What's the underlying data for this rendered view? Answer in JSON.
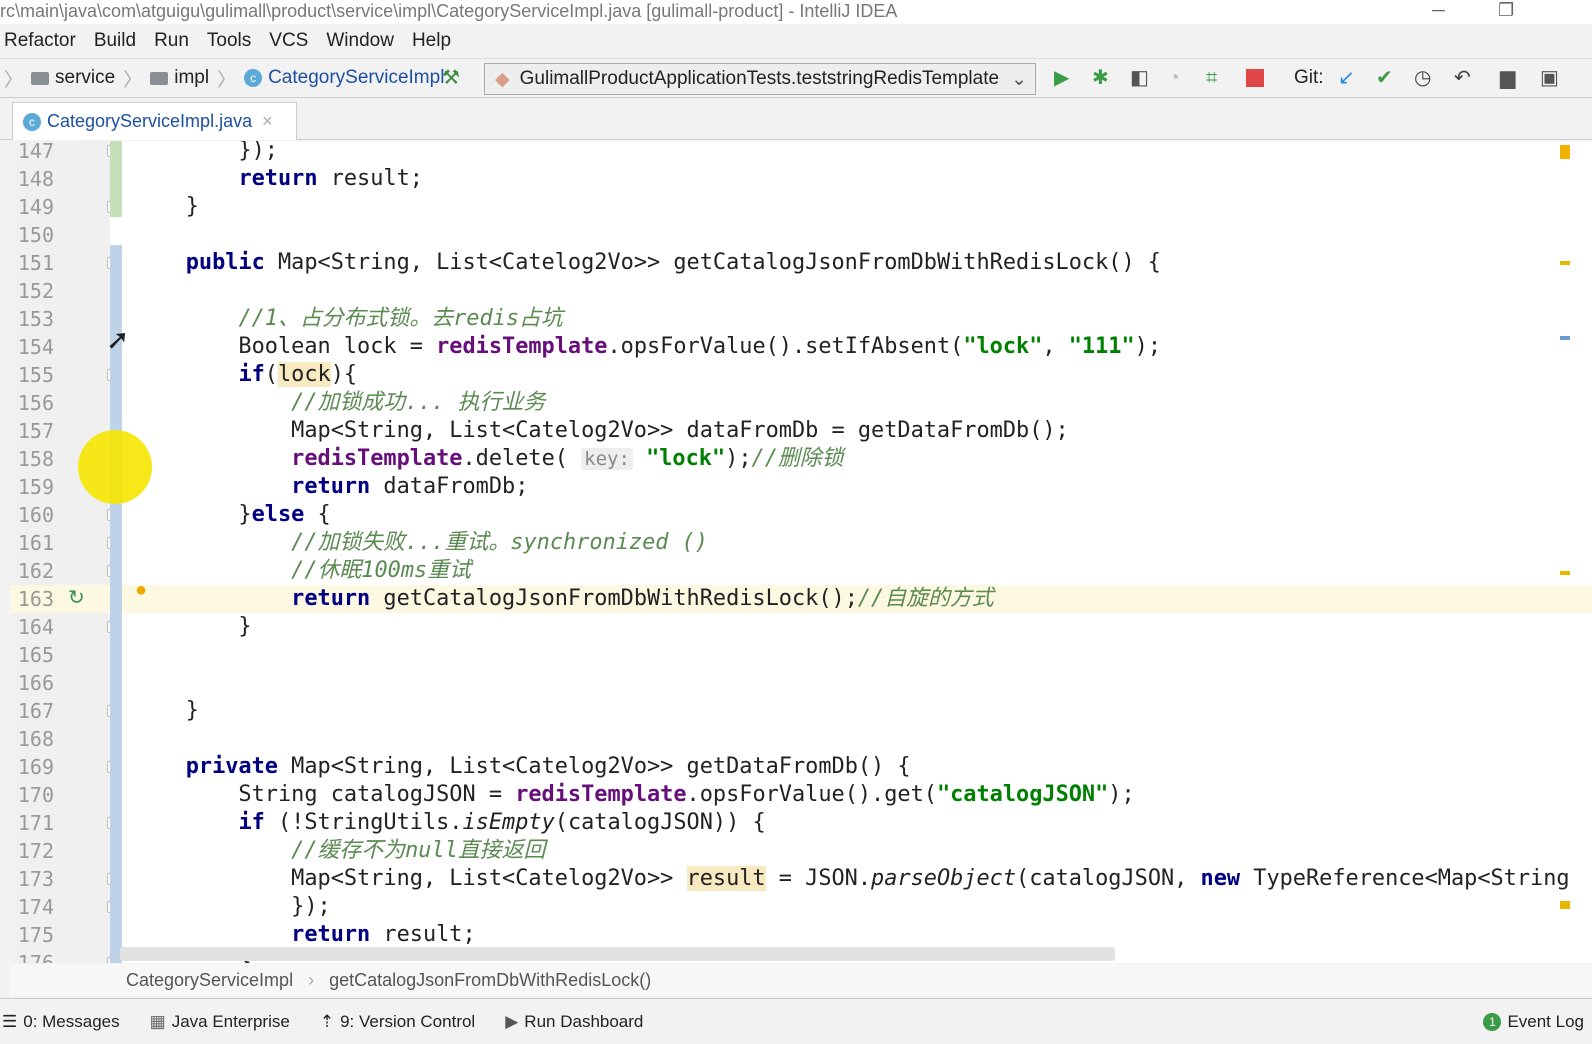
{
  "window": {
    "title": "rc\\main\\java\\com\\atguigu\\gulimall\\product\\service\\impl\\CategoryServiceImpl.java [gulimall-product] - IntelliJ IDEA"
  },
  "menu": [
    "Refactor",
    "Build",
    "Run",
    "Tools",
    "VCS",
    "Window",
    "Help"
  ],
  "nav": {
    "crumbs": [
      "service",
      "impl",
      "CategoryServiceImpl"
    ],
    "run_config": "GulimallProductApplicationTests.teststringRedisTemplate",
    "git_label": "Git:"
  },
  "tab": {
    "label": "CategoryServiceImpl.java"
  },
  "code": [
    {
      "n": "147",
      "t": [
        [
          "t",
          "        });"
        ]
      ]
    },
    {
      "n": "148",
      "t": [
        [
          "t",
          "        "
        ],
        [
          "k",
          "return"
        ],
        [
          "t",
          " result;"
        ]
      ]
    },
    {
      "n": "149",
      "t": [
        [
          "t",
          "    }"
        ]
      ]
    },
    {
      "n": "150",
      "t": []
    },
    {
      "n": "151",
      "t": [
        [
          "t",
          "    "
        ],
        [
          "k",
          "public"
        ],
        [
          "t",
          " Map<String, List<Catelog2Vo>> getCatalogJsonFromDbWithRedisLock() {"
        ]
      ]
    },
    {
      "n": "152",
      "t": []
    },
    {
      "n": "153",
      "t": [
        [
          "t",
          "        "
        ],
        [
          "c",
          "//1、占分布式锁。去redis占坑"
        ]
      ]
    },
    {
      "n": "154",
      "t": [
        [
          "t",
          "        Boolean lock = "
        ],
        [
          "f",
          "redisTemplate"
        ],
        [
          "t",
          ".opsForValue().setIfAbsent("
        ],
        [
          "s",
          "\"lock\""
        ],
        [
          "t",
          ", "
        ],
        [
          "s",
          "\"111\""
        ],
        [
          "t",
          ");"
        ]
      ]
    },
    {
      "n": "155",
      "t": [
        [
          "t",
          "        "
        ],
        [
          "k",
          "if"
        ],
        [
          "t",
          "("
        ],
        [
          "hl",
          "lock"
        ],
        [
          "t",
          "){"
        ]
      ]
    },
    {
      "n": "156",
      "t": [
        [
          "t",
          "            "
        ],
        [
          "c",
          "//加锁成功... 执行业务"
        ]
      ]
    },
    {
      "n": "157",
      "t": [
        [
          "t",
          "            Map<String, List<Catelog2Vo>> dataFromDb = getDataFromDb();"
        ]
      ]
    },
    {
      "n": "158",
      "t": [
        [
          "t",
          "            "
        ],
        [
          "f",
          "redisTemplate"
        ],
        [
          "t",
          ".delete( "
        ],
        [
          "hint",
          "key:"
        ],
        [
          "t",
          " "
        ],
        [
          "s",
          "\"lock\""
        ],
        [
          "t",
          ");"
        ],
        [
          "c",
          "//删除锁"
        ]
      ]
    },
    {
      "n": "159",
      "t": [
        [
          "t",
          "            "
        ],
        [
          "k",
          "return"
        ],
        [
          "t",
          " dataFromDb;"
        ]
      ]
    },
    {
      "n": "160",
      "t": [
        [
          "t",
          "        }"
        ],
        [
          "k",
          "else"
        ],
        [
          "t",
          " {"
        ]
      ]
    },
    {
      "n": "161",
      "t": [
        [
          "t",
          "            "
        ],
        [
          "c",
          "//加锁失败...重试。synchronized ()"
        ]
      ]
    },
    {
      "n": "162",
      "t": [
        [
          "t",
          "            "
        ],
        [
          "c",
          "//休眠100ms重试"
        ]
      ]
    },
    {
      "n": "163",
      "t": [
        [
          "t",
          "            "
        ],
        [
          "k",
          "return"
        ],
        [
          "t",
          " getCatalogJsonFromDbWithRedisLock();"
        ],
        [
          "c",
          "//自旋的方式"
        ]
      ],
      "current": true
    },
    {
      "n": "164",
      "t": [
        [
          "t",
          "        }"
        ]
      ]
    },
    {
      "n": "165",
      "t": []
    },
    {
      "n": "166",
      "t": []
    },
    {
      "n": "167",
      "t": [
        [
          "t",
          "    }"
        ]
      ]
    },
    {
      "n": "168",
      "t": []
    },
    {
      "n": "169",
      "t": [
        [
          "t",
          "    "
        ],
        [
          "k",
          "private"
        ],
        [
          "t",
          " Map<String, List<Catelog2Vo>> getDataFromDb() {"
        ]
      ]
    },
    {
      "n": "170",
      "t": [
        [
          "t",
          "        String catalogJSON = "
        ],
        [
          "f",
          "redisTemplate"
        ],
        [
          "t",
          ".opsForValue().get("
        ],
        [
          "s",
          "\"catalogJSON\""
        ],
        [
          "t",
          ");"
        ]
      ]
    },
    {
      "n": "171",
      "t": [
        [
          "t",
          "        "
        ],
        [
          "k",
          "if"
        ],
        [
          "t",
          " (!StringUtils."
        ],
        [
          "it",
          "isEmpty"
        ],
        [
          "t",
          "(catalogJSON)) {"
        ]
      ]
    },
    {
      "n": "172",
      "t": [
        [
          "t",
          "            "
        ],
        [
          "c",
          "//缓存不为null直接返回"
        ]
      ]
    },
    {
      "n": "173",
      "t": [
        [
          "t",
          "            Map<String, List<Catelog2Vo>> "
        ],
        [
          "hl",
          "result"
        ],
        [
          "t",
          " = JSON."
        ],
        [
          "it",
          "parseObject"
        ],
        [
          "t",
          "(catalogJSON, "
        ],
        [
          "k",
          "new"
        ],
        [
          "t",
          " TypeReference<Map<String"
        ]
      ]
    },
    {
      "n": "174",
      "t": [
        [
          "t",
          "            });"
        ]
      ]
    },
    {
      "n": "175",
      "t": [
        [
          "t",
          "            "
        ],
        [
          "k",
          "return"
        ],
        [
          "t",
          " result;"
        ]
      ]
    },
    {
      "n": "176",
      "t": [
        [
          "t",
          "        }"
        ]
      ]
    }
  ],
  "breadcrumb": [
    "CategoryServiceImpl",
    "getCatalogJsonFromDbWithRedisLock()"
  ],
  "toolwindows": [
    "0: Messages",
    "Java Enterprise",
    "9: Version Control",
    "Run Dashboard"
  ],
  "event_log": {
    "count": "1",
    "label": "Event Log"
  }
}
